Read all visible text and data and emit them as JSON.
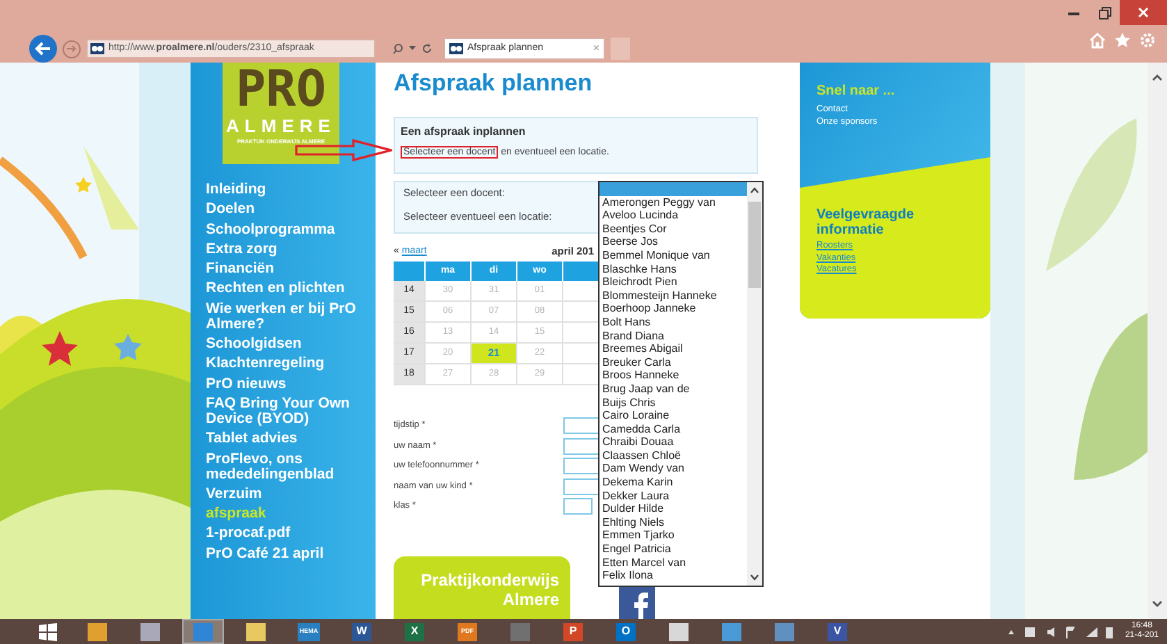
{
  "browser": {
    "url": "http://www.**proalmere.nl**/ouders/2310_afspraak",
    "tab": {
      "title": "Afspraak plannen",
      "close": "×"
    }
  },
  "logo": {
    "mark": "PRO",
    "name": "ALMERE",
    "tagline": "PRAKTIJK ONDERWIJS ALMERE"
  },
  "nav": [
    {
      "label": "Inleiding",
      "selected": false
    },
    {
      "label": "Doelen",
      "selected": false
    },
    {
      "label": "Schoolprogramma",
      "selected": false
    },
    {
      "label": "Extra zorg",
      "selected": false
    },
    {
      "label": "Financiën",
      "selected": false
    },
    {
      "label": "Rechten en plichten",
      "selected": false
    },
    {
      "label": "Wie werken er bij PrO Almere?",
      "selected": false
    },
    {
      "label": "Schoolgidsen",
      "selected": false
    },
    {
      "label": "Klachtenregeling",
      "selected": false
    },
    {
      "label": "PrO nieuws",
      "selected": false
    },
    {
      "label": "FAQ Bring Your Own Device (BYOD)",
      "selected": false
    },
    {
      "label": "Tablet advies",
      "selected": false
    },
    {
      "label": "ProFlevo, ons mededelingenblad",
      "selected": false
    },
    {
      "label": "Verzuim",
      "selected": false
    },
    {
      "label": "afspraak",
      "selected": true
    },
    {
      "label": "1-procaf.pdf",
      "selected": false
    },
    {
      "label": "PrO Café 21 april",
      "selected": false
    }
  ],
  "page": {
    "title": "Afspraak plannen",
    "intro": {
      "heading": "Een afspraak inplannen",
      "highlight": "Selecteer een docent",
      "rest": " en eventueel een locatie."
    },
    "selectors": [
      "Selecteer een docent:",
      "Selecteer eventueel een locatie:"
    ],
    "calendar": {
      "prev_arrow": "«",
      "prev": "maart",
      "month": "april 201",
      "columns": [
        "ma",
        "di",
        "wo"
      ],
      "rows": [
        {
          "week": "14",
          "days": [
            {
              "label": "30",
              "selected": false
            },
            {
              "label": "31",
              "selected": false
            },
            {
              "label": "01",
              "selected": false
            }
          ]
        },
        {
          "week": "15",
          "days": [
            {
              "label": "06",
              "selected": false
            },
            {
              "label": "07",
              "selected": false
            },
            {
              "label": "08",
              "selected": false
            }
          ]
        },
        {
          "week": "16",
          "days": [
            {
              "label": "13",
              "selected": false
            },
            {
              "label": "14",
              "selected": false
            },
            {
              "label": "15",
              "selected": false
            }
          ]
        },
        {
          "week": "17",
          "days": [
            {
              "label": "20",
              "selected": false
            },
            {
              "label": "21",
              "selected": true
            },
            {
              "label": "22",
              "selected": false
            }
          ]
        },
        {
          "week": "18",
          "days": [
            {
              "label": "27",
              "selected": false
            },
            {
              "label": "28",
              "selected": false
            },
            {
              "label": "29",
              "selected": false
            }
          ]
        }
      ]
    },
    "form": [
      {
        "label": "tijdstip *",
        "kind": "wide"
      },
      {
        "label": "uw naam *",
        "kind": "wide"
      },
      {
        "label": "uw telefoonnummer *",
        "kind": "wide"
      },
      {
        "label": "naam van uw kind *",
        "kind": "wide"
      },
      {
        "label": "klas *",
        "kind": "narrow"
      }
    ],
    "banner": "Praktijkonderwijs Almere"
  },
  "dropdown": {
    "items": [
      {
        "selected": true
      },
      {
        "label": "Amerongen Peggy van",
        "selected": false
      },
      {
        "label": "Aveloo Lucinda",
        "selected": false
      },
      {
        "label": "Beentjes Cor",
        "selected": false
      },
      {
        "label": "Beerse Jos",
        "selected": false
      },
      {
        "label": "Bemmel Monique van",
        "selected": false
      },
      {
        "label": "Blaschke Hans",
        "selected": false
      },
      {
        "label": "Bleichrodt Pien",
        "selected": false
      },
      {
        "label": "Blommesteijn Hanneke",
        "selected": false
      },
      {
        "label": "Boerhoop Janneke",
        "selected": false
      },
      {
        "label": "Bolt Hans",
        "selected": false
      },
      {
        "label": "Brand Diana",
        "selected": false
      },
      {
        "label": "Breemes Abigail",
        "selected": false
      },
      {
        "label": "Breuker Carla",
        "selected": false
      },
      {
        "label": "Broos Hanneke",
        "selected": false
      },
      {
        "label": "Brug Jaap van de",
        "selected": false
      },
      {
        "label": "Buijs Chris",
        "selected": false
      },
      {
        "label": "Cairo Loraine",
        "selected": false
      },
      {
        "label": "Camedda Carla",
        "selected": false
      },
      {
        "label": "Chraibi Douaa",
        "selected": false
      },
      {
        "label": "Claassen Chloë",
        "selected": false
      },
      {
        "label": "Dam Wendy van",
        "selected": false
      },
      {
        "label": "Dekema Karin",
        "selected": false
      },
      {
        "label": "Dekker Laura",
        "selected": false
      },
      {
        "label": "Dulder Hilde",
        "selected": false
      },
      {
        "label": "Ehlting Niels",
        "selected": false
      },
      {
        "label": "Emmen Tjarko",
        "selected": false
      },
      {
        "label": "Engel Patricia",
        "selected": false
      },
      {
        "label": "Etten Marcel van",
        "selected": false
      },
      {
        "label": "Felix Ilona",
        "selected": false
      }
    ]
  },
  "quick_links": {
    "title": "Snel naar ...",
    "links": [
      "Contact",
      "Onze sponsors"
    ]
  },
  "faq": {
    "title": "Veelgevraagde informatie",
    "links": [
      "Roosters",
      "Vakanties",
      "Vacatures"
    ]
  },
  "taskbar": {
    "apps": [
      {
        "color": "#e0a030",
        "active": false
      },
      {
        "color": "#a8a8b8",
        "active": false
      },
      {
        "color": "#2f86d6",
        "active": true
      },
      {
        "color": "#e8c860",
        "active": false
      },
      {
        "color": "#2a7fc0",
        "label": "HEMA",
        "active": false
      },
      {
        "color": "#2b5797",
        "label": "W",
        "active": false
      },
      {
        "color": "#1e7145",
        "label": "X",
        "active": false
      },
      {
        "color": "#e07820",
        "label": "PDF",
        "active": false
      },
      {
        "color": "#707070",
        "active": false
      },
      {
        "color": "#d24726",
        "label": "P",
        "active": false
      },
      {
        "color": "#0072c6",
        "label": "O",
        "active": false
      },
      {
        "color": "#d8d8d8",
        "active": false
      },
      {
        "color": "#4a9ad8",
        "active": false
      },
      {
        "color": "#6090c0",
        "active": false
      },
      {
        "color": "#3955a3",
        "label": "V",
        "active": false
      }
    ],
    "clock": {
      "time": "16:48",
      "date": "21-4-201"
    }
  }
}
